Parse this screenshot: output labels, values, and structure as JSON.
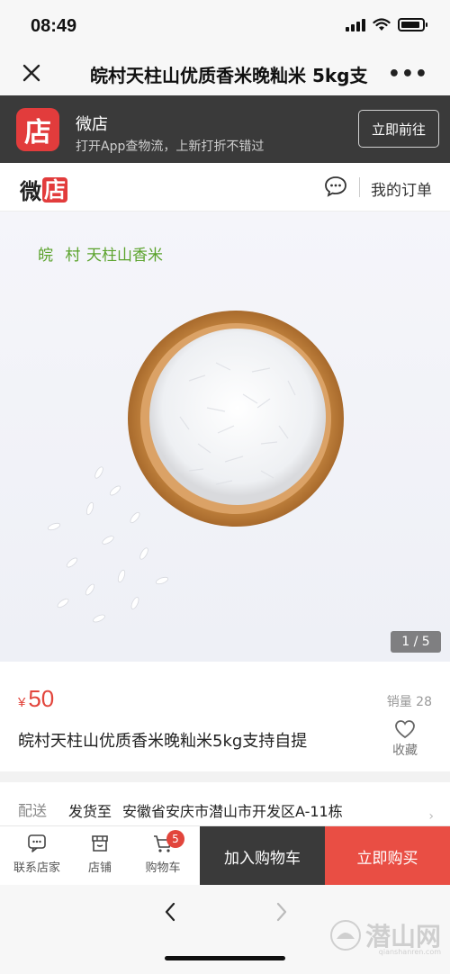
{
  "status_bar": {
    "time": "08:49"
  },
  "nav": {
    "title": "皖村天柱山优质香米晚籼米 5kg支",
    "more": "•••"
  },
  "banner": {
    "logo_char": "店",
    "app_name": "微店",
    "subtitle": "打开App查物流，上新打折不错过",
    "button": "立即前往"
  },
  "shop_header": {
    "logo_a": "微",
    "logo_b": "店",
    "my_orders": "我的订单"
  },
  "product_image": {
    "brand_a": "皖 村",
    "brand_b": "天柱山香米",
    "counter": "1 / 5"
  },
  "product": {
    "currency": "¥",
    "price": "50",
    "sales": "销量 28",
    "title": "皖村天柱山优质香米晚籼米5kg支持自提",
    "favorite": "收藏"
  },
  "delivery": {
    "label": "配送",
    "to": "发货至",
    "address": "安徽省安庆市潜山市开发区A-11栋"
  },
  "action_bar": {
    "contact": "联系店家",
    "shop": "店铺",
    "cart": "购物车",
    "cart_count": "5",
    "add_to_cart": "加入购物车",
    "buy_now": "立即购买"
  },
  "watermark": {
    "text": "潜山网",
    "sub": "qianshanren.com"
  },
  "colors": {
    "accent": "#e94e44",
    "price": "#e2453c",
    "banner_bg": "#3a3a3a",
    "brand_green": "#5aa22b"
  }
}
